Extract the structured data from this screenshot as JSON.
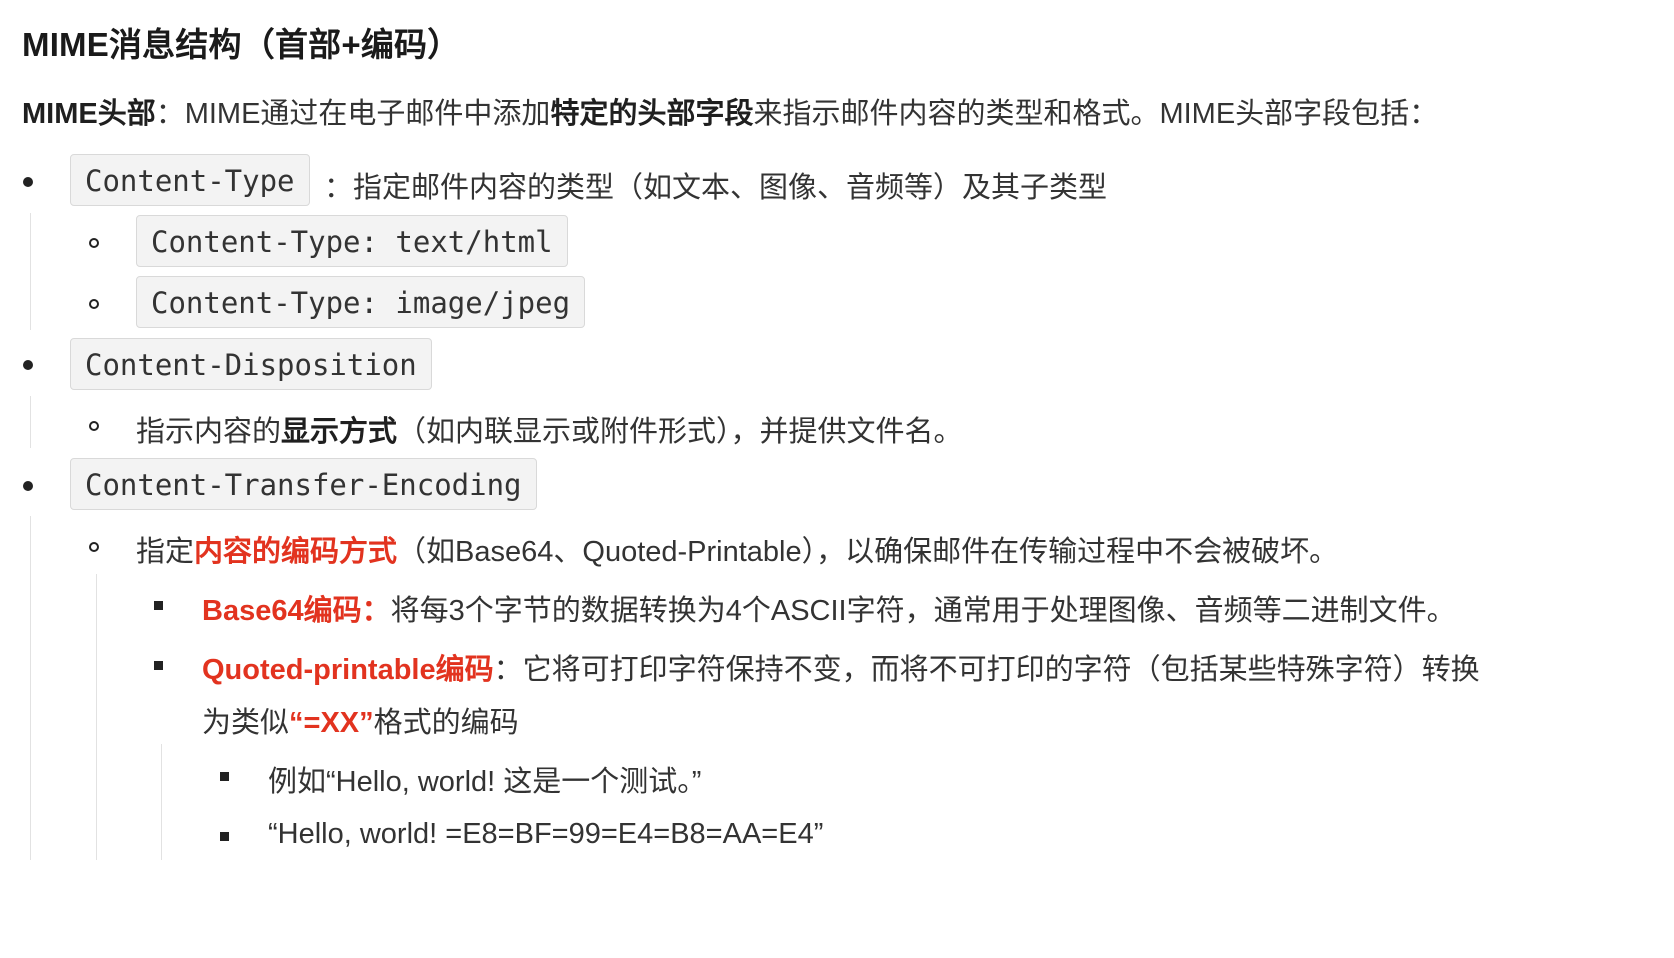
{
  "heading": "MIME消息结构（首部+编码）",
  "intro": {
    "b1": "MIME头部",
    "t1": "：MIME通过在电子邮件中添加",
    "b2": "特定的头部字段",
    "t2": "来指示邮件内容的类型和格式。MIME头部字段包括："
  },
  "items": [
    {
      "code": "Content-Type",
      "text": "：指定邮件内容的类型（如文本、图像、音频等）及其子类型",
      "sub_codes": [
        "Content-Type: text/html",
        "Content-Type: image/jpeg"
      ]
    },
    {
      "code": "Content-Disposition",
      "sub": {
        "t1": "指示内容的",
        "b1": "显示方式",
        "t2": "（如内联显示或附件形式），并提供文件名。"
      }
    },
    {
      "code": "Content-Transfer-Encoding",
      "sub": {
        "t1": "指定",
        "r1": "内容的编码方式",
        "t2": "（如Base64、Quoted-Printable），以确保邮件在传输过程中不会被破坏。"
      },
      "details": [
        {
          "label": "Base64编码：",
          "text": "将每3个字节的数据转换为4个ASCII字符，通常用于处理图像、音频等二进制文件。"
        },
        {
          "label": "Quoted-printable编码",
          "text": "：它将可打印字符保持不变，而将不可打印的字符（包括某些特殊字符）转换",
          "line2_a": "为类似",
          "line2_r": "“=XX”",
          "line2_b": "格式的编码",
          "examples": [
            "例如“Hello, world! 这是一个测试。”",
            "“Hello, world! =E8=BF=99=E4=B8=AA=E4”"
          ]
        }
      ]
    }
  ]
}
